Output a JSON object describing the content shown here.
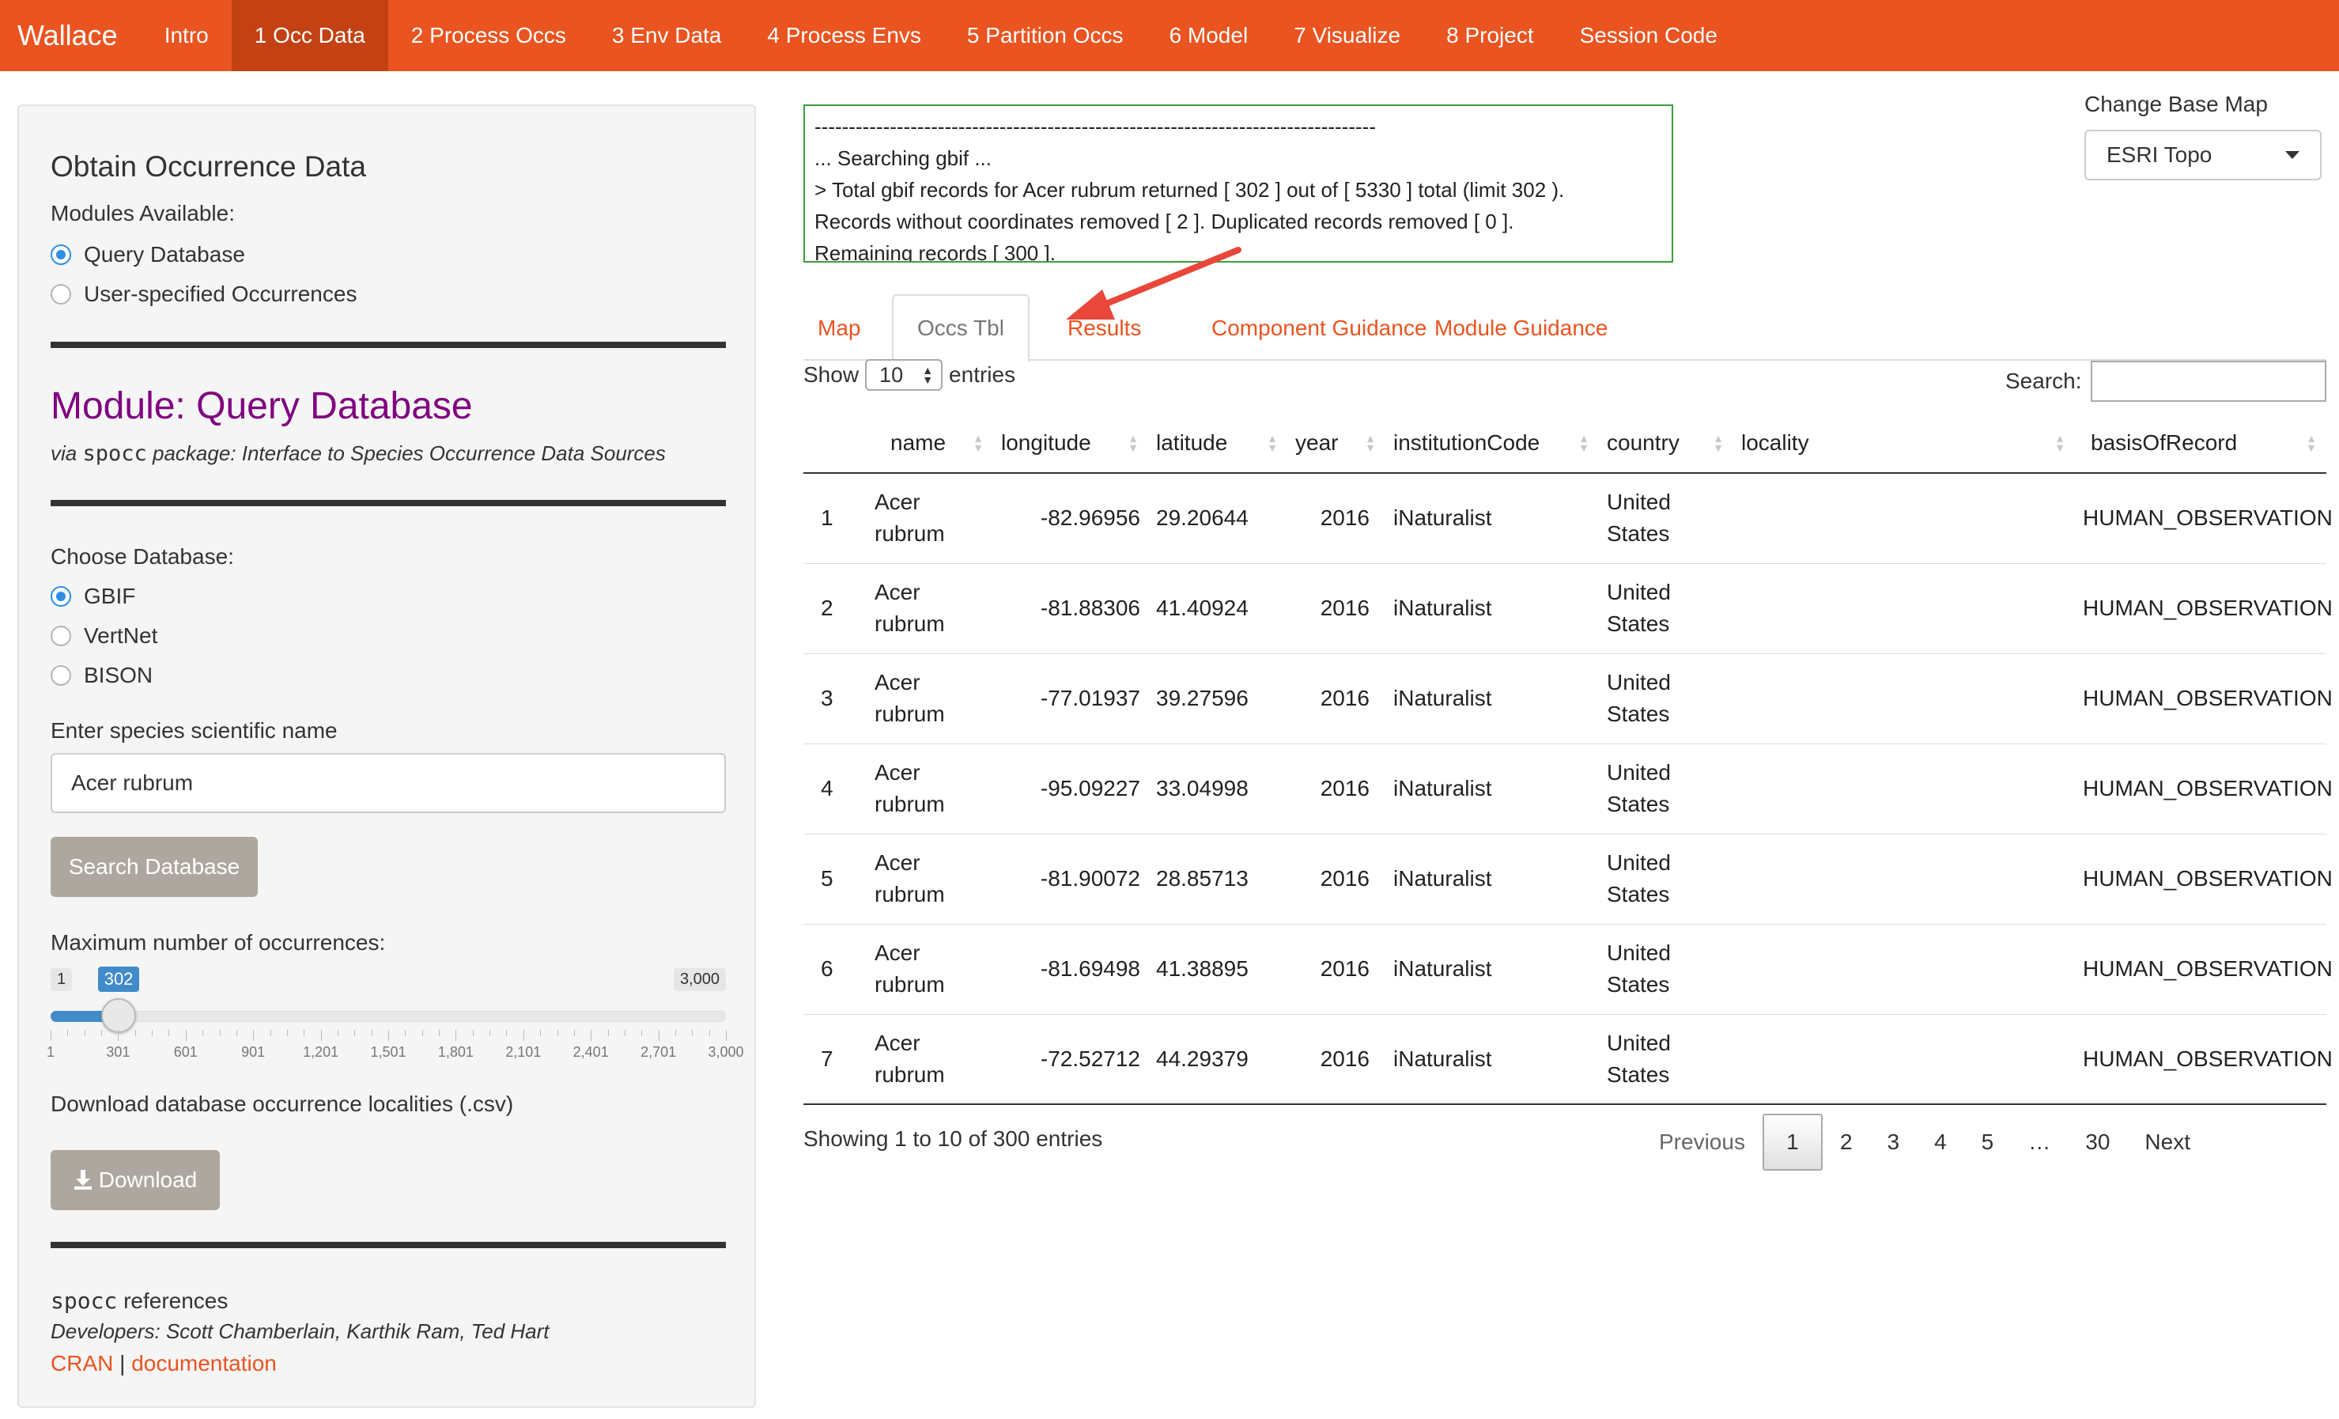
{
  "navbar": {
    "brand": "Wallace",
    "items": [
      "Intro",
      "1 Occ Data",
      "2 Process Occs",
      "3 Env Data",
      "4 Process Envs",
      "5 Partition Occs",
      "6 Model",
      "7 Visualize",
      "8 Project",
      "Session Code"
    ],
    "active_index": 1,
    "color": "#e95420",
    "active_color": "#c34113"
  },
  "sidebar": {
    "heading": "Obtain Occurrence Data",
    "modules_label": "Modules Available:",
    "modules": [
      {
        "label": "Query Database",
        "selected": true
      },
      {
        "label": "User-specified Occurrences",
        "selected": false
      }
    ],
    "module_title": "Module: Query Database",
    "via_prefix": "via",
    "via_pkg": "spocc",
    "via_suffix": "package: Interface to Species Occurrence Data Sources",
    "db_label": "Choose Database:",
    "databases": [
      {
        "label": "GBIF",
        "selected": true
      },
      {
        "label": "VertNet",
        "selected": false
      },
      {
        "label": "BISON",
        "selected": false
      }
    ],
    "species_label": "Enter species scientific name",
    "species_value": "Acer rubrum",
    "search_button": "Search Database",
    "max_label": "Maximum number of occurrences:",
    "slider": {
      "min": 1,
      "max": 3000,
      "value": 302,
      "min_label": "1",
      "max_label": "3,000",
      "value_label": "302",
      "ticks": [
        "1",
        "301",
        "601",
        "901",
        "1,201",
        "1,501",
        "1,801",
        "2,101",
        "2,401",
        "2,701",
        "3,000"
      ]
    },
    "download_label": "Download database occurrence localities (.csv)",
    "download_button": "Download",
    "refs_pkg": "spocc",
    "refs_suffix": "references",
    "developers": "Developers: Scott Chamberlain, Karthik Ram, Ted Hart",
    "link_cran": "CRAN",
    "link_sep": "|",
    "link_docs": "documentation"
  },
  "log": {
    "lines": [
      "----------------------------------------------------------------------------------",
      "... Searching gbif ...",
      "> Total gbif records for Acer rubrum returned [ 302 ] out of [ 5330 ] total (limit 302 ).",
      "Records without coordinates removed [ 2 ]. Duplicated records removed [ 0 ].",
      "Remaining records [ 300 ]."
    ]
  },
  "basemap": {
    "label": "Change Base Map",
    "value": "ESRI Topo"
  },
  "tabs": [
    "Map",
    "Occs Tbl",
    "Results",
    "Component Guidance",
    "Module Guidance"
  ],
  "active_tab": 1,
  "table": {
    "show_label": "Show",
    "page_length": "10",
    "entries_label": "entries",
    "search_label": "Search:",
    "columns": [
      "",
      "name",
      "longitude",
      "latitude",
      "year",
      "institutionCode",
      "country",
      "locality",
      "basisOfRecord"
    ],
    "rows": [
      [
        "1",
        "Acer rubrum",
        "-82.96956",
        "29.20644",
        "2016",
        "iNaturalist",
        "United States",
        "",
        "HUMAN_OBSERVATION"
      ],
      [
        "2",
        "Acer rubrum",
        "-81.88306",
        "41.40924",
        "2016",
        "iNaturalist",
        "United States",
        "",
        "HUMAN_OBSERVATION"
      ],
      [
        "3",
        "Acer rubrum",
        "-77.01937",
        "39.27596",
        "2016",
        "iNaturalist",
        "United States",
        "",
        "HUMAN_OBSERVATION"
      ],
      [
        "4",
        "Acer rubrum",
        "-95.09227",
        "33.04998",
        "2016",
        "iNaturalist",
        "United States",
        "",
        "HUMAN_OBSERVATION"
      ],
      [
        "5",
        "Acer rubrum",
        "-81.90072",
        "28.85713",
        "2016",
        "iNaturalist",
        "United States",
        "",
        "HUMAN_OBSERVATION"
      ],
      [
        "6",
        "Acer rubrum",
        "-81.69498",
        "41.38895",
        "2016",
        "iNaturalist",
        "United States",
        "",
        "HUMAN_OBSERVATION"
      ],
      [
        "7",
        "Acer rubrum",
        "-72.52712",
        "44.29379",
        "2016",
        "iNaturalist",
        "United States",
        "",
        "HUMAN_OBSERVATION"
      ]
    ],
    "info": "Showing 1 to 10 of 300 entries",
    "pager": {
      "previous": "Previous",
      "pages": [
        "1",
        "2",
        "3",
        "4",
        "5",
        "…",
        "30"
      ],
      "current": "1",
      "next": "Next"
    }
  },
  "colors": {
    "accent": "#e95420",
    "module_title": "#800080",
    "log_border": "#3c9c3c",
    "slider": "#428bca"
  }
}
